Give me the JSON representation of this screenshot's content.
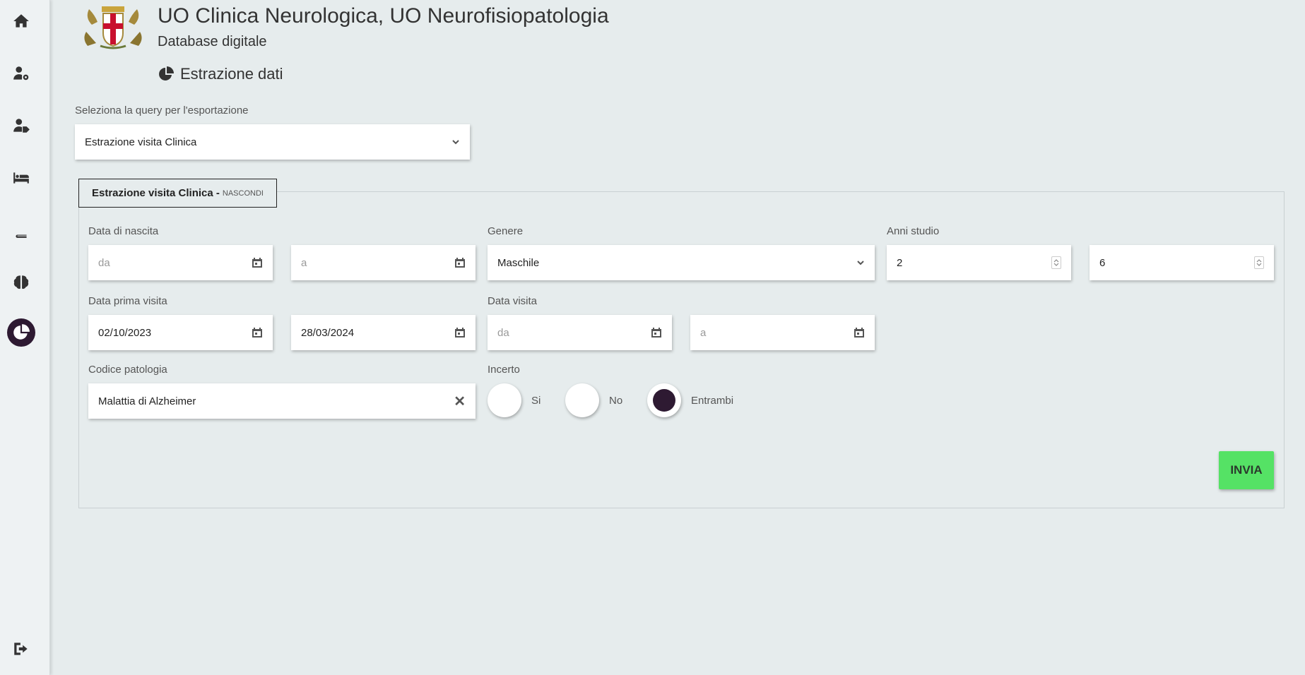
{
  "header": {
    "title": "UO Clinica Neurologica, UO Neurofisiopatologia",
    "subtitle": "Database digitale",
    "section_title": "Estrazione dati"
  },
  "sidebar": {
    "items": [
      {
        "name": "home",
        "icon": "home-icon"
      },
      {
        "name": "user-settings",
        "icon": "user-gear-icon"
      },
      {
        "name": "user-tag",
        "icon": "user-tag-icon"
      },
      {
        "name": "bed",
        "icon": "bed-icon"
      },
      {
        "name": "medical-book",
        "icon": "medical-book-icon"
      },
      {
        "name": "brain",
        "icon": "brain-icon"
      },
      {
        "name": "data-export",
        "icon": "pie-chart-icon",
        "active": true
      },
      {
        "name": "logout",
        "icon": "sign-out-icon"
      }
    ]
  },
  "query": {
    "label": "Seleziona la query per l'esportazione",
    "selected": "Estrazione visita Clinica"
  },
  "form": {
    "legend_title": "Estrazione visita Clinica -",
    "legend_toggle": "NASCONDI",
    "birth_date": {
      "label": "Data di nascita",
      "from_placeholder": "da",
      "to_placeholder": "a"
    },
    "gender": {
      "label": "Genere",
      "selected": "Maschile"
    },
    "study_years": {
      "label": "Anni studio",
      "from": "2",
      "to": "6"
    },
    "first_visit": {
      "label": "Data prima visita",
      "from": "02/10/2023",
      "to": "28/03/2024"
    },
    "visit_date": {
      "label": "Data visita",
      "from_placeholder": "da",
      "to_placeholder": "a"
    },
    "pathology": {
      "label": "Codice patologia",
      "value": "Malattia di Alzheimer"
    },
    "uncertain": {
      "label": "Incerto",
      "options": [
        "Si",
        "No",
        "Entrambi"
      ],
      "selected": "Entrambi"
    },
    "submit_label": "INVIA"
  },
  "colors": {
    "background": "#e6eced",
    "accent": "#2e1a32",
    "submit": "#55e265"
  }
}
